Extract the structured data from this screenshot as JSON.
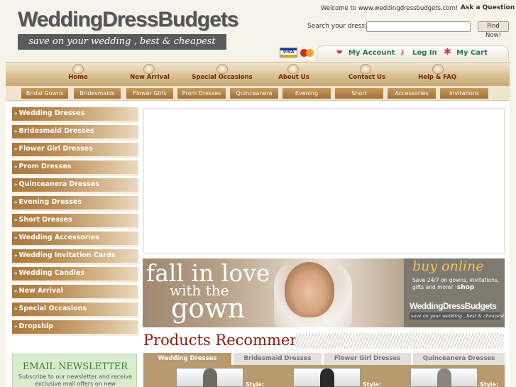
{
  "logo": {
    "title": "WeddingDressBudgets",
    "tagline": "save on your wedding , best & cheapest"
  },
  "header": {
    "welcome": "Welcome to www.weddingdressbudgets.com!",
    "ask": "Ask a Question",
    "search_label": "Search your dress:",
    "search_value": "",
    "find_button": "Find Now!"
  },
  "payment": {
    "visa": "VISA"
  },
  "account": {
    "my_account": "My Account",
    "login": "Log In",
    "cart": "My Cart"
  },
  "nav": {
    "items": [
      "Home",
      "New Arrival",
      "Special Occasions",
      "About Us",
      "Contact Us",
      "Help & FAQ"
    ]
  },
  "subnav": {
    "items": [
      "Bridal Gowns",
      "Bridesmaids",
      "Flower Girls",
      "Prom Dresses",
      "Quinceanera",
      "Evening",
      "Short",
      "Accessories",
      "Invitations"
    ]
  },
  "sidebar": {
    "items": [
      "Wedding Dresses",
      "Bridesmaid Dresses",
      "Flower Girl Dresses",
      "Prom Dresses",
      "Quinceanera Dresses",
      "Evening Dresses",
      "Short Dresses",
      "Wedding Accessories",
      "Wedding Invitation Cards",
      "Wedding Candles",
      "New Arrival",
      "Special Occasions",
      "Dropship"
    ]
  },
  "newsletter": {
    "title": "EMAIL NEWSLETTER",
    "text": "Subscribe to our newsletter and receive exclusive mail offers on new"
  },
  "banner": {
    "line1": "fall in love",
    "line2": "with the",
    "line3": "gown",
    "buy_online": "buy online",
    "buy_text": "Save 24/7 on gowns, invitations, gifts and more!",
    "shop": "shop",
    "logo": "WeddingDressBudgets",
    "tagline": "save on your wedding , best & cheapest"
  },
  "products": {
    "title": "Products Recommend",
    "tabs": [
      "Wedding Dresses",
      "Bridesmaid Dresses",
      "Flower Girl Dresses",
      "Quinceanera Dresses"
    ],
    "active_tab": 0,
    "style_label": "Style:"
  },
  "colors": {
    "accent": "#8a1a0a",
    "nav_text": "#6a2a05",
    "account_link": "#2a7a52",
    "sidebar": "#a9793f"
  }
}
